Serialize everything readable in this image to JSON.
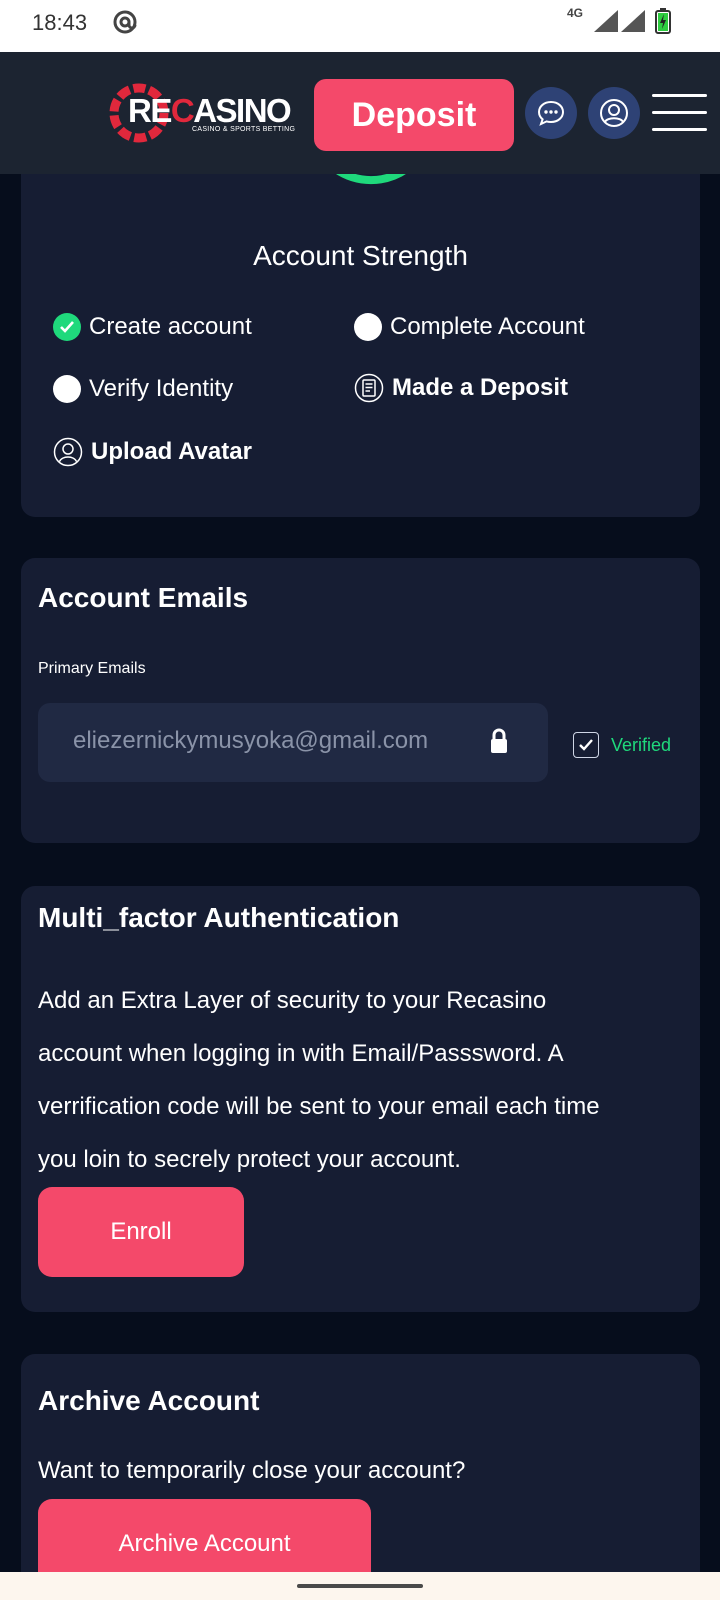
{
  "status_bar": {
    "time": "18:43",
    "network": "4G",
    "icons": [
      "at-sign-icon",
      "signal-icon",
      "signal-icon",
      "battery-charging-icon"
    ]
  },
  "header": {
    "logo_brand_a": "RE",
    "logo_brand_b": "C",
    "logo_brand_c": "ASINO",
    "logo_tagline": "CASINO & SPORTS BETTING",
    "deposit_label": "Deposit",
    "icons": [
      "chat-icon",
      "user-icon",
      "hamburger-menu-icon"
    ]
  },
  "strength": {
    "title": "Account Strength",
    "steps": [
      {
        "label": "Create account",
        "done": true
      },
      {
        "label": "Complete Account",
        "done": false
      },
      {
        "label": "Verify Identity",
        "done": false
      },
      {
        "label": "Made a Deposit",
        "icon": "receipt-icon"
      },
      {
        "label": "Upload Avatar",
        "icon": "avatar-icon"
      }
    ]
  },
  "emails": {
    "title": "Account Emails",
    "primary_label": "Primary Emails",
    "primary_value": "eliezernickymusyoka@gmail.com",
    "status": "Verified"
  },
  "mfa": {
    "title": "Multi_factor Authentication",
    "line1": "Add an Extra Layer of security to your Recasino",
    "line2": "account when logging in with Email/Passsword. A",
    "line3": "verrification code will be sent to your email each time",
    "line4": "you loin to secrely protect your account.",
    "button": "Enroll"
  },
  "archive": {
    "title": "Archive Account",
    "body": "Want to temporarily close your account?",
    "button": "Archive Account"
  },
  "colors": {
    "accent": "#f4496a",
    "success": "#1fd97c",
    "card": "#161d33",
    "background": "#060d1c",
    "header": "#1c2431"
  }
}
